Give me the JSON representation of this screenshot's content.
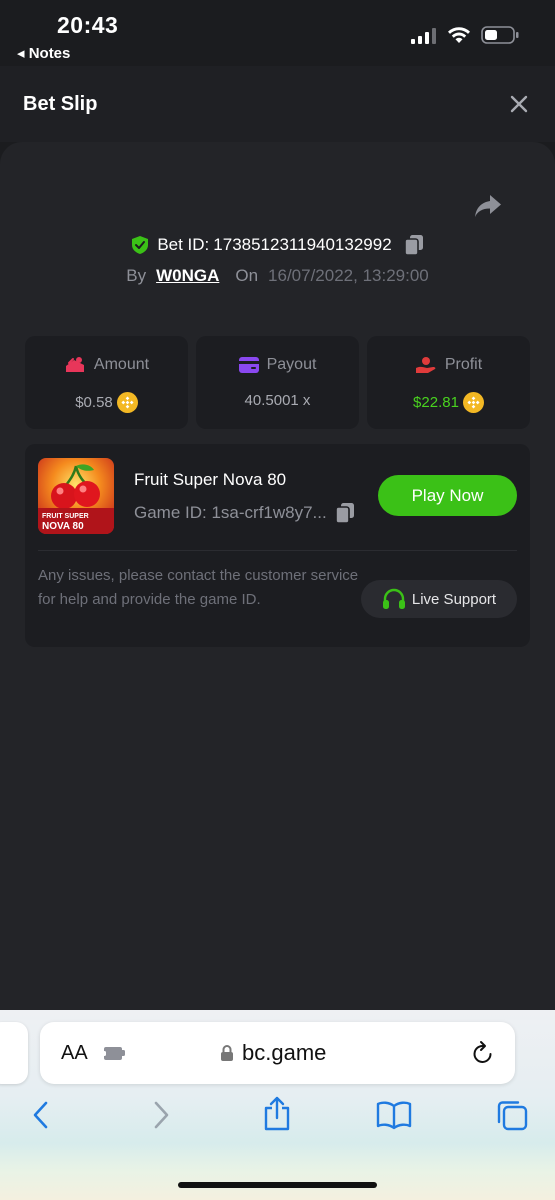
{
  "status_bar": {
    "time": "20:43",
    "back_label": "◂ Notes"
  },
  "header": {
    "title": "Bet Slip"
  },
  "bet": {
    "id_label": "Bet ID:",
    "id_value": "1738512311940132992",
    "by_label": "By",
    "username": "W0NGA",
    "on_label": "On",
    "date": "16/07/2022, 13:29:00"
  },
  "stats": {
    "amount_label": "Amount",
    "amount_value": "$0.58",
    "payout_label": "Payout",
    "payout_value": "40.5001 x",
    "profit_label": "Profit",
    "profit_value": "$22.81"
  },
  "game": {
    "title": "Fruit Super Nova 80",
    "game_id": "Game ID: 1sa-crf1w8y7...",
    "thumb_text_line1": "FRUIT SUPER",
    "thumb_text_line2": "NOVA 80",
    "play_label": "Play Now",
    "issues_text": "Any issues, please contact the customer service for help and provide the game ID.",
    "support_label": "Live Support"
  },
  "browser": {
    "aa_label": "AA",
    "url": "bc.game"
  },
  "colors": {
    "accent_green": "#3bc117",
    "profit_green": "#49d21f",
    "coin": "#f3b824",
    "background": "#232428"
  }
}
